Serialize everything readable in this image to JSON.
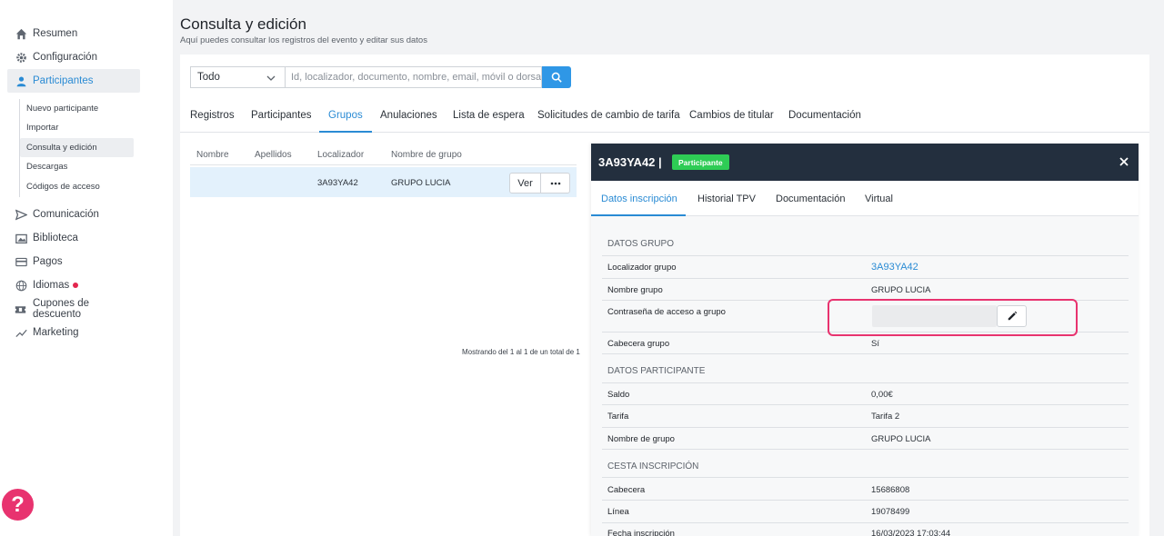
{
  "colors": {
    "accent": "#2a8bd4",
    "badge": "#2ecc55",
    "header": "#232f3e",
    "highlight": "#e8336f"
  },
  "sidebar": {
    "items": [
      {
        "label": "Resumen",
        "icon": "home-icon"
      },
      {
        "label": "Configuración",
        "icon": "gear-icon"
      },
      {
        "label": "Participantes",
        "icon": "user-icon",
        "active": true
      },
      {
        "label": "Comunicación",
        "icon": "send-icon"
      },
      {
        "label": "Biblioteca",
        "icon": "gallery-icon"
      },
      {
        "label": "Pagos",
        "icon": "credit-card-icon"
      },
      {
        "label": "Idiomas",
        "icon": "globe-icon",
        "notification": true
      },
      {
        "label": "Cupones de descuento",
        "icon": "ticket-icon"
      },
      {
        "label": "Marketing",
        "icon": "trend-icon"
      }
    ],
    "sub_items": [
      {
        "label": "Nuevo participante"
      },
      {
        "label": "Importar"
      },
      {
        "label": "Consulta y edición",
        "active": true
      },
      {
        "label": "Descargas"
      },
      {
        "label": "Códigos de acceso"
      }
    ],
    "help_label": "?"
  },
  "header": {
    "title": "Consulta y edición",
    "subtitle": "Aquí puedes consultar los registros del evento y editar sus datos"
  },
  "search": {
    "filter_value": "Todo",
    "placeholder": "Id, localizador, documento, nombre, email, móvil o dorsal"
  },
  "tabs": [
    {
      "label": "Registros"
    },
    {
      "label": "Participantes"
    },
    {
      "label": "Grupos",
      "active": true
    },
    {
      "label": "Anulaciones"
    },
    {
      "label": "Lista de espera"
    },
    {
      "label": "Solicitudes de cambio de tarifa"
    },
    {
      "label": "Cambios de titular"
    },
    {
      "label": "Documentación"
    }
  ],
  "table": {
    "columns": [
      "Nombre",
      "Apellidos",
      "Localizador",
      "Nombre de grupo"
    ],
    "rows": [
      {
        "nombre": "",
        "apellidos": "",
        "localizador": "3A93YA42",
        "grupo": "GRUPO LUCIA"
      }
    ],
    "view_label": "Ver",
    "pagination": "Mostrando del 1 al 1 de un total de 1"
  },
  "panel": {
    "title": "3A93YA42 |",
    "badge": "Participante",
    "tabs": [
      {
        "label": "Datos inscripción",
        "active": true
      },
      {
        "label": "Historial TPV"
      },
      {
        "label": "Documentación"
      },
      {
        "label": "Virtual"
      }
    ],
    "group_section": {
      "title": "DATOS GRUPO",
      "fields": [
        {
          "label": "Localizador grupo",
          "value": "3A93YA42"
        },
        {
          "label": "Nombre grupo",
          "value": "GRUPO LUCIA"
        },
        {
          "label": "Contraseña de acceso a grupo",
          "value": ""
        },
        {
          "label": "Cabecera grupo",
          "value": "Sí"
        }
      ]
    },
    "participant_section": {
      "title": "DATOS PARTICIPANTE",
      "fields": [
        {
          "label": "Saldo",
          "value": "0,00€"
        },
        {
          "label": "Tarifa",
          "value": "Tarifa 2"
        },
        {
          "label": "Nombre de grupo",
          "value": "GRUPO LUCIA"
        }
      ]
    },
    "basket_section": {
      "title": "CESTA INSCRIPCIÓN",
      "fields": [
        {
          "label": "Cabecera",
          "value": "15686808"
        },
        {
          "label": "Línea",
          "value": "19078499"
        },
        {
          "label": "Fecha inscripción",
          "value": "16/03/2023 17:03:44"
        }
      ]
    }
  }
}
